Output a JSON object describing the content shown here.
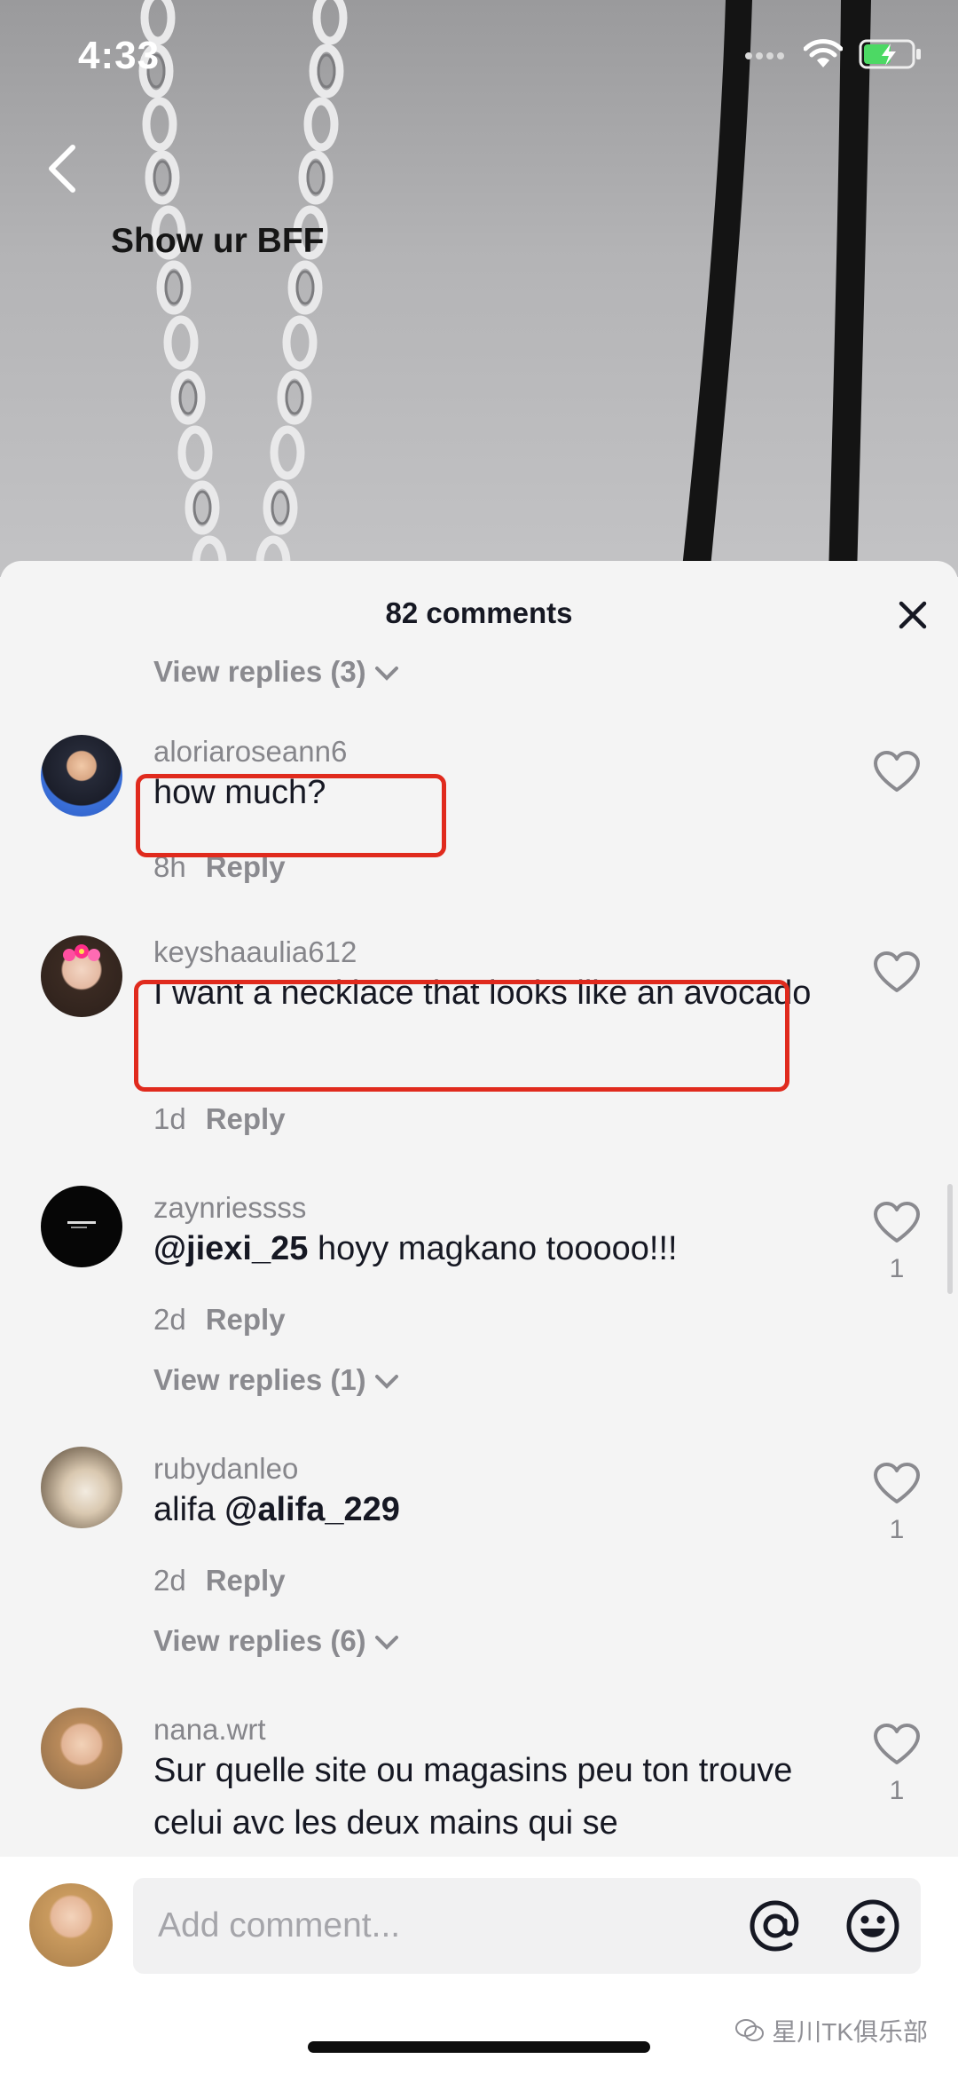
{
  "status_bar": {
    "time": "4:33"
  },
  "video": {
    "overlay_text": "Show ur BFF"
  },
  "sheet": {
    "title": "82 comments"
  },
  "partial_view_replies": "View replies (3)",
  "comments": [
    {
      "username": "aloriaroseann6",
      "text": "how much?",
      "time": "8h",
      "reply": "Reply",
      "likes": ""
    },
    {
      "username": "keyshaaulia612",
      "text": "I want a necklace that looks like an avocado",
      "time": "1d",
      "reply": "Reply",
      "likes": ""
    },
    {
      "username": "zaynriessss",
      "mention": "@jiexi_25",
      "text": " hoyy magkano tooooo!!!",
      "time": "2d",
      "reply": "Reply",
      "likes": "1",
      "view_replies": "View replies (1)"
    },
    {
      "username": "rubydanleo",
      "text": "alifa ",
      "mention": "@alifa_229",
      "time": "2d",
      "reply": "Reply",
      "likes": "1",
      "view_replies": "View replies (6)"
    },
    {
      "username": "nana.wrt",
      "text": "Sur quelle site ou magasins peu ton trouve celui avc les deux mains qui se",
      "likes": "1"
    }
  ],
  "input": {
    "placeholder": "Add comment..."
  },
  "watermark": "星川TK俱乐部",
  "colors": {
    "highlight": "#e02a1d",
    "muted": "#86868b",
    "sheet_bg": "#f4f4f4"
  }
}
